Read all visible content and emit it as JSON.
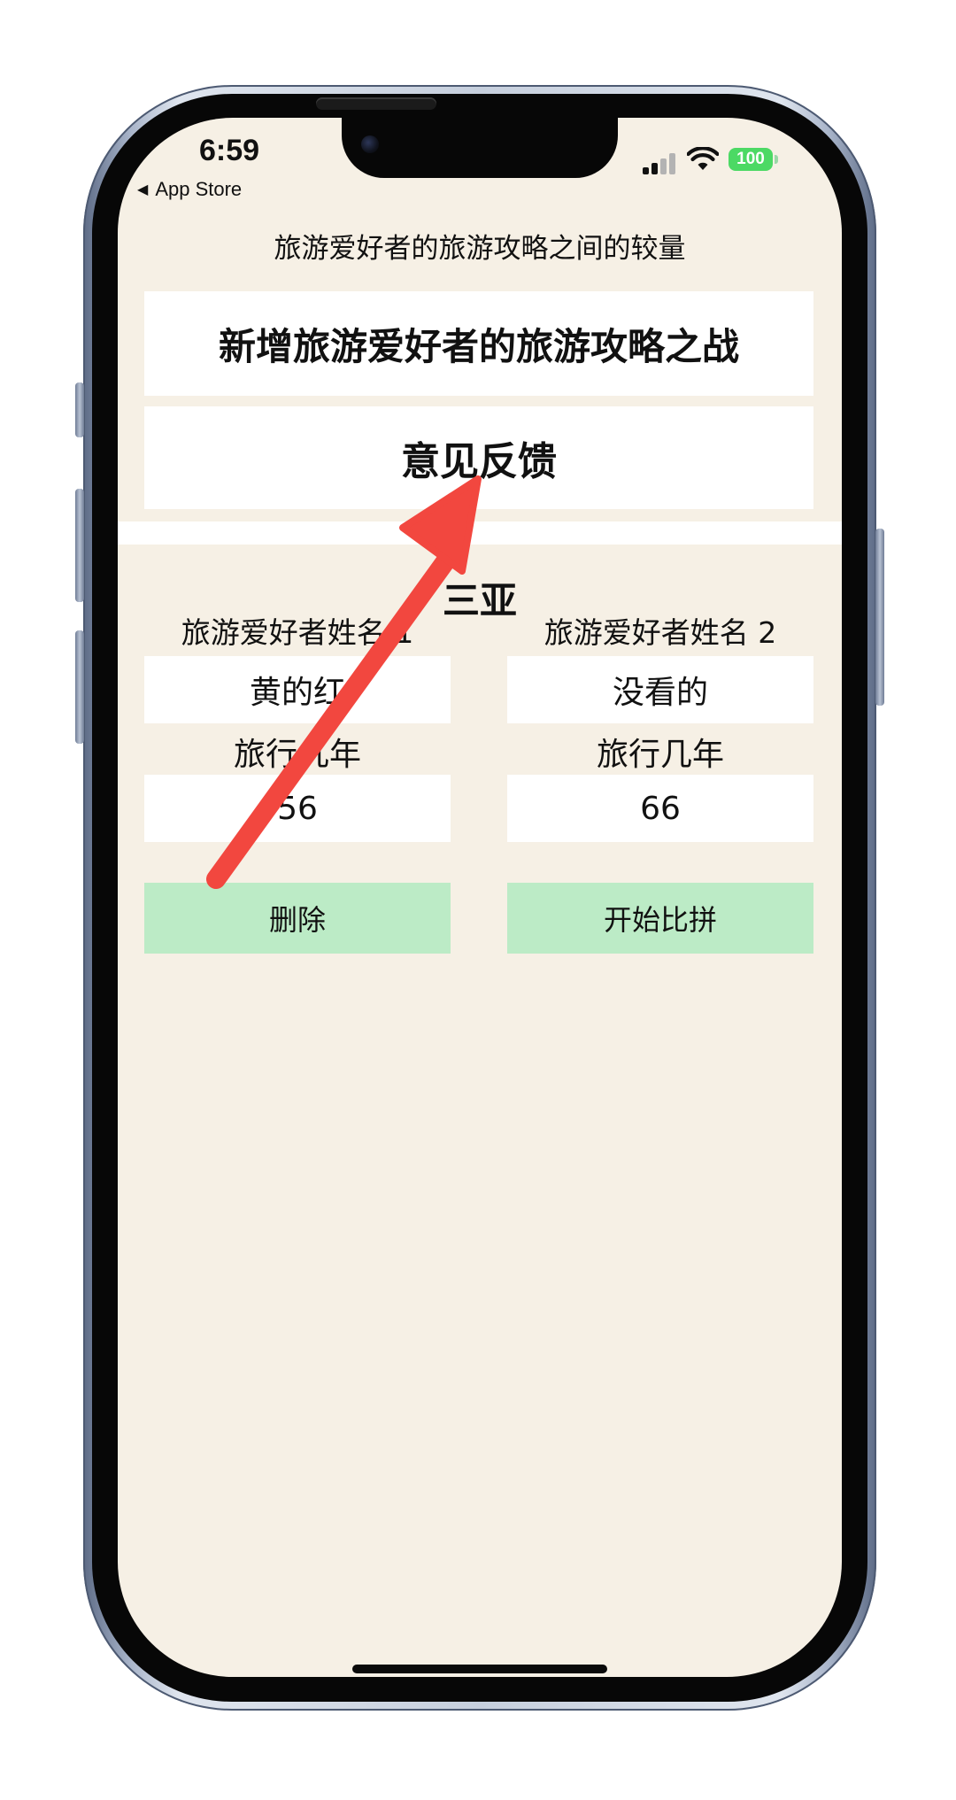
{
  "status_bar": {
    "time": "6:59",
    "back_label": "App Store",
    "battery": "100"
  },
  "app": {
    "title": "旅游爱好者的旅游攻略之间的较量",
    "new_battle_label": "新增旅游爱好者的旅游攻略之战",
    "feedback_label": "意见反馈"
  },
  "battle": {
    "destination": "三亚",
    "left": {
      "name_label": "旅游爱好者姓名 1",
      "name_value": "黄的红",
      "years_label": "旅行几年",
      "years_value": "56",
      "action_label": "删除"
    },
    "right": {
      "name_label": "旅游爱好者姓名 2",
      "name_value": "没看的",
      "years_label": "旅行几年",
      "years_value": "66",
      "action_label": "开始比拼"
    }
  },
  "colors": {
    "screen_background": "#f6f0e5",
    "card_background": "#ffffff",
    "action_button": "#bcebc6",
    "annotation_arrow": "#f2473f",
    "battery": "#4cd964"
  }
}
